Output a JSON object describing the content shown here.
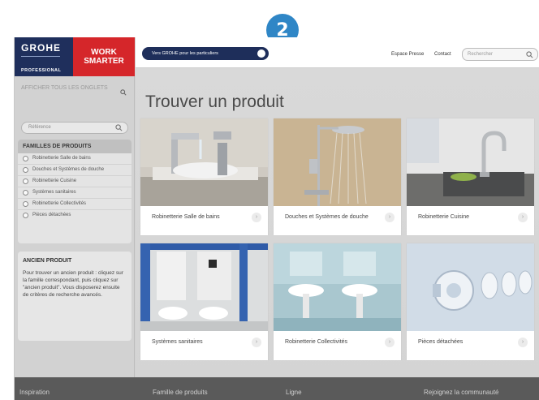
{
  "step_badge": "2",
  "logo": {
    "brand": "GROHE",
    "sub": "PROFESSIONAL",
    "tagline_line1": "WORK",
    "tagline_line2": "SMARTER"
  },
  "sidebar": {
    "show_tabs": "AFFICHER TOUS LES ONGLETS",
    "reference_placeholder": "Référence",
    "families_title": "FAMILLES DE PRODUITS",
    "families": [
      "Robinetterie Salle de bains",
      "Douches et Systèmes de douche",
      "Robinetterie Cuisine",
      "Systèmes sanitaires",
      "Robinetterie Collectivités",
      "Pièces détachées"
    ],
    "old_product_title": "ANCIEN PRODUIT",
    "old_product_text": "Pour trouver un ancien produit : cliquez sur la famille correspondant, puis cliquez sur \"ancien produit\". Vous disposerez ensuite de critères de recherche avancés."
  },
  "topbar": {
    "pill_label": "Vers GROHE pour les particuliers",
    "links": [
      "Espace Presse",
      "Contact"
    ],
    "search_placeholder": "Rechercher"
  },
  "main": {
    "title": "Trouver un produit",
    "cards": [
      {
        "label": "Robinetterie Salle de bains"
      },
      {
        "label": "Douches et Systèmes de douche"
      },
      {
        "label": "Robinetterie Cuisine"
      },
      {
        "label": "Systèmes sanitaires"
      },
      {
        "label": "Robinetterie Collectivités"
      },
      {
        "label": "Pièces détachées"
      }
    ]
  },
  "footer": {
    "items": [
      "Inspiration",
      "Famille de produits",
      "Ligne",
      "Rejoignez la communauté"
    ]
  },
  "colors": {
    "grohe_blue": "#1f2f5c",
    "work_smarter_red": "#d5262a",
    "badge_blue": "#2f86c6"
  }
}
